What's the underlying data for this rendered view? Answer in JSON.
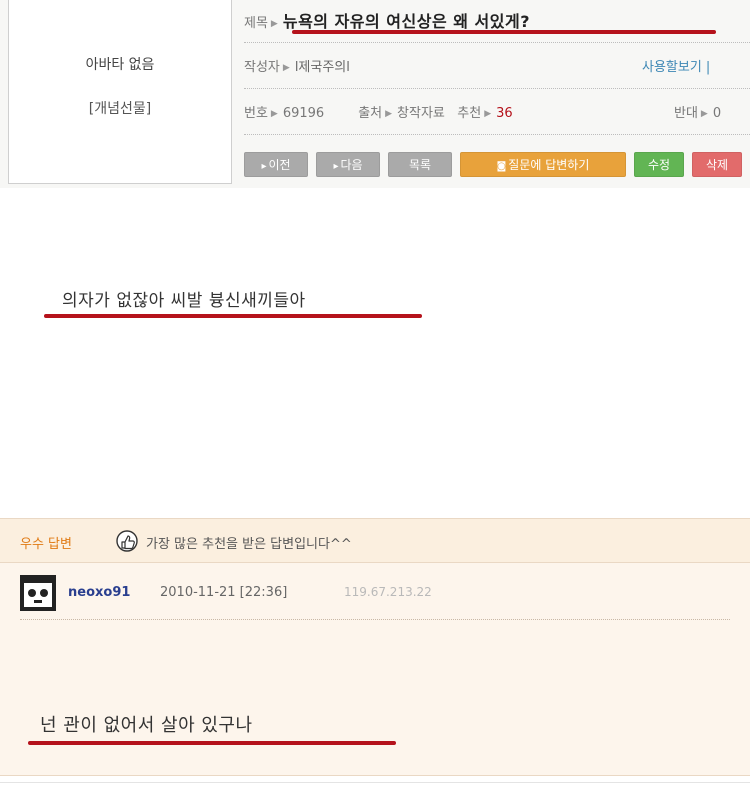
{
  "header": {
    "avatar_text": "아바타 없음",
    "avatar_sub": "[개념선물]",
    "title_label": "제목",
    "title": "뉴욕의 자유의 여신상은 왜 서있게?",
    "author_label": "작성자",
    "author": "l제국주의l",
    "contacts_link": "사용할보기 |",
    "number_label": "번호",
    "number": "69196",
    "source_label": "출처",
    "source": "창작자료",
    "recommend_label": "추천",
    "recommend": "36",
    "oppose_label": "반대",
    "oppose": "0",
    "buttons": {
      "prev": "이전",
      "next": "다음",
      "list": "목록",
      "answer": "질문에 답변하기",
      "edit": "수정",
      "delete": "삭제"
    }
  },
  "post": {
    "text": "의자가 없잖아 씨발 븅신새끼들아"
  },
  "best_answer": {
    "label": "우수 답변",
    "message": "가장 많은 추천을 받은 답변입니다^^",
    "username": "neoxo91",
    "datetime": "2010-11-21 [22:36]",
    "ip": "119.67.213.22",
    "text": "넌 관이 없어서 살아 있구나"
  },
  "colors": {
    "underline_red": "#b5121b",
    "button_gray": "#aaaaaa",
    "button_orange": "#e8a23b",
    "button_green": "#62b554",
    "button_red": "#e26b6b",
    "best_bg": "#fdf5ec"
  },
  "icons": [
    "chevron-right-icon",
    "thumbs-up-icon",
    "user-avatar-icon",
    "question-icon"
  ]
}
